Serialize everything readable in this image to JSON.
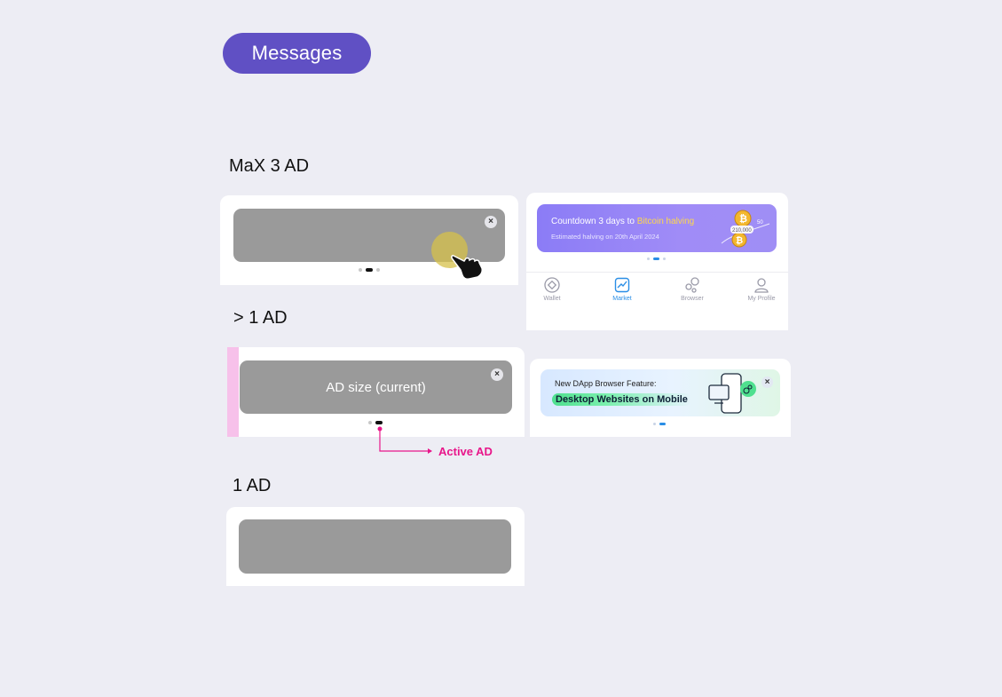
{
  "header": {
    "pill_label": "Messages"
  },
  "sections": {
    "max3": {
      "title": "MaX 3 AD"
    },
    "gt1": {
      "title": "> 1 AD",
      "ad_label": "AD size (current)",
      "annotation": "Active AD"
    },
    "one": {
      "title": "1 AD"
    }
  },
  "btc_banner": {
    "title_prefix": "Countdown 3 days to ",
    "title_highlight": "Bitcoin halving",
    "subtitle": "Estimated halving on 20th April 2024",
    "art_number": "210,000",
    "art_number_small": "50"
  },
  "tabbar": {
    "tabs": [
      {
        "label": "Wallet",
        "icon": "wallet-icon"
      },
      {
        "label": "Market",
        "icon": "market-chart-icon"
      },
      {
        "label": "Browser",
        "icon": "browser-icon"
      },
      {
        "label": "My Profile",
        "icon": "profile-icon"
      }
    ]
  },
  "dapp_banner": {
    "title": "New DApp Browser Feature:",
    "highlight": "Desktop Websites on Mobile"
  },
  "colors": {
    "accent": "#6050c4",
    "placeholder": "#9a9a9a",
    "annotation": "#e8168a",
    "active_tab": "#2a8ee6"
  },
  "icons": {
    "close": "close-icon",
    "hand": "pointing-hand-icon",
    "close_glyph": "×"
  }
}
